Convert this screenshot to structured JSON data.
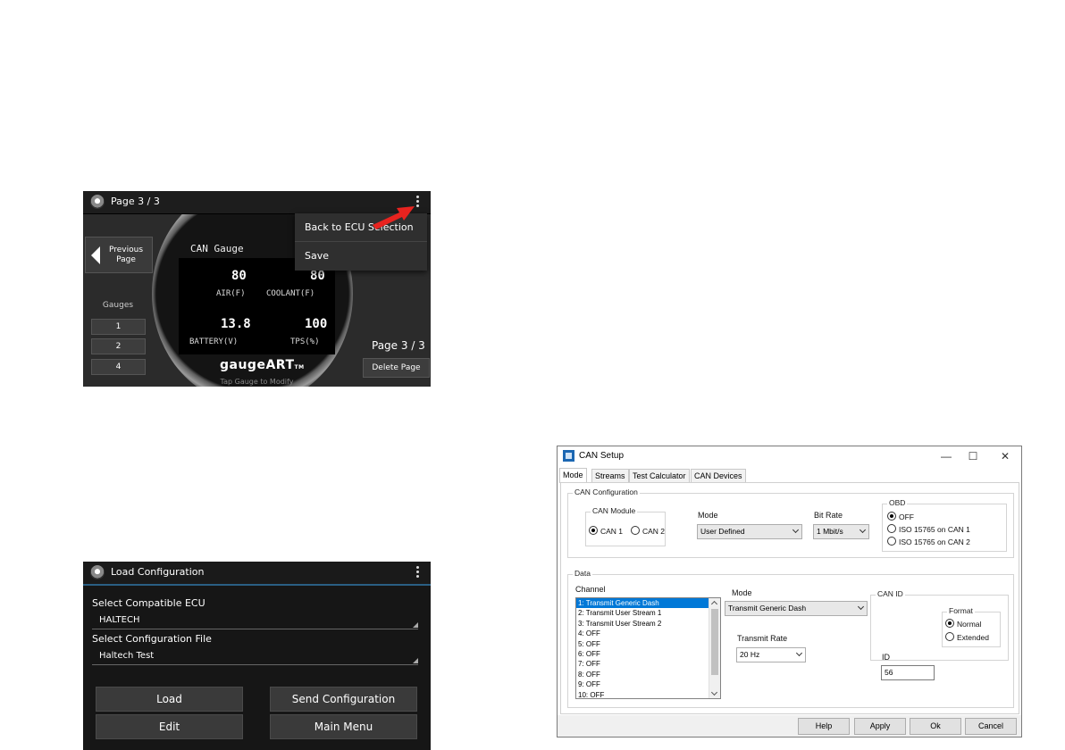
{
  "gauge_screen": {
    "title": "Page 3 / 3",
    "previous_page_label": "Previous Page",
    "gauges_label": "Gauges",
    "gauge_buttons": [
      "1",
      "2",
      "4"
    ],
    "gauge_title": "CAN Gauge",
    "readings": [
      {
        "value": "80",
        "label": "AIR(F)"
      },
      {
        "value": "80",
        "label": "COOLANT(F)"
      },
      {
        "value": "13.8",
        "label": "BATTERY(V)"
      },
      {
        "value": "100",
        "label": "TPS(%)"
      }
    ],
    "brand": "gaugeART",
    "brand_tm": "TM",
    "hint": "Tap Gauge to Modify",
    "page_indicator": "Page 3 / 3",
    "delete_page_label": "Delete Page",
    "menu": [
      "Back to ECU Selection",
      "Save"
    ],
    "arrow_color": "#e8231f"
  },
  "load_screen": {
    "title": "Load Configuration",
    "ecu_label": "Select Compatible ECU",
    "ecu_value": "HALTECH",
    "file_label": "Select Configuration File",
    "file_value": "Haltech Test",
    "buttons": [
      "Load",
      "Send Configuration",
      "Edit",
      "Main Menu"
    ],
    "accent_color": "#2a5f83"
  },
  "can_dialog": {
    "title": "CAN Setup",
    "window_controls": [
      "—",
      "☐",
      "✕"
    ],
    "tabs": [
      "Mode",
      "Streams",
      "Test Calculator",
      "CAN Devices"
    ],
    "active_tab": "Mode",
    "can_config": {
      "legend": "CAN Configuration",
      "module_legend": "CAN Module",
      "module_options": [
        "CAN 1",
        "CAN 2"
      ],
      "module_selected": "CAN 1",
      "mode_label": "Mode",
      "mode_value": "User Defined",
      "bitrate_label": "Bit Rate",
      "bitrate_value": "1 Mbit/s",
      "obd_legend": "OBD",
      "obd_options": [
        "OFF",
        "ISO 15765 on CAN 1",
        "ISO 15765 on CAN 2"
      ],
      "obd_selected": "OFF"
    },
    "data": {
      "legend": "Data",
      "channel_label": "Channel",
      "channels": [
        "1: Transmit Generic Dash",
        "2: Transmit User Stream 1",
        "3: Transmit User Stream 2",
        "4: OFF",
        "5: OFF",
        "6: OFF",
        "7: OFF",
        "8: OFF",
        "9: OFF",
        "10: OFF"
      ],
      "selected_channel": "1: Transmit Generic Dash",
      "mode_label": "Mode",
      "mode_value": "Transmit Generic Dash",
      "rate_label": "Transmit Rate",
      "rate_value": "20 Hz",
      "canid_legend": "CAN ID",
      "id_label": "ID",
      "id_value": "56",
      "format_legend": "Format",
      "format_options": [
        "Normal",
        "Extended"
      ],
      "format_selected": "Normal"
    },
    "buttons": [
      "Help",
      "Apply",
      "Ok",
      "Cancel"
    ],
    "selection_color": "#0078d7"
  }
}
